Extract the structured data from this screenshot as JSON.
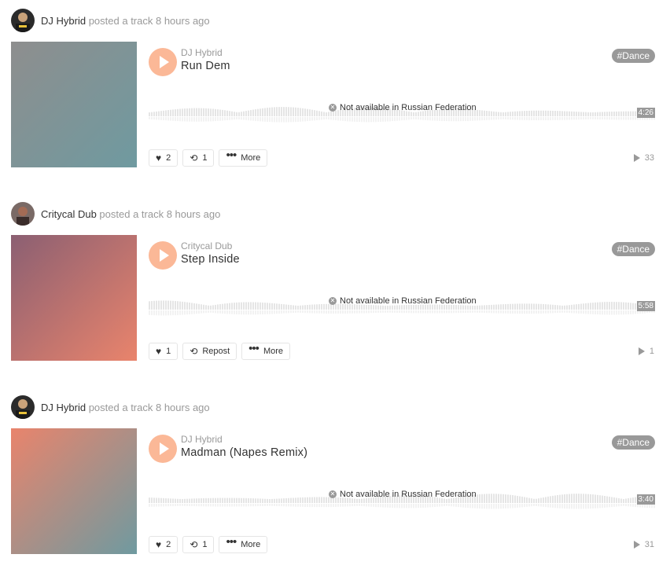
{
  "posts": [
    {
      "user": "DJ Hybrid",
      "action": "posted a track 8 hours ago",
      "artist": "DJ Hybrid",
      "title": "Run Dem",
      "tag": "#Dance",
      "availability": "Not available in Russian Federation",
      "duration": "4:26",
      "likes": "2",
      "reposts": "1",
      "more_label": "More",
      "plays": "33",
      "art_colors": [
        "#8e8e8e",
        "#6f9aa0"
      ]
    },
    {
      "user": "Critycal Dub",
      "action": "posted a track 8 hours ago",
      "artist": "Critycal Dub",
      "title": "Step Inside",
      "tag": "#Dance",
      "availability": "Not available in Russian Federation",
      "duration": "5:58",
      "likes": "1",
      "reposts": "Repost",
      "more_label": "More",
      "plays": "1",
      "art_colors": [
        "#8b5f72",
        "#e9846c"
      ]
    },
    {
      "user": "DJ Hybrid",
      "action": "posted a track 8 hours ago",
      "artist": "DJ Hybrid",
      "title": "Madman (Napes Remix)",
      "tag": "#Dance",
      "availability": "Not available in Russian Federation",
      "duration": "3:40",
      "likes": "2",
      "reposts": "1",
      "more_label": "More",
      "plays": "31",
      "art_colors": [
        "#e9846c",
        "#6f9aa0"
      ]
    }
  ],
  "colors": {
    "accent": "#fbb897",
    "muted": "#999999",
    "waveform": "#e5e5e5"
  }
}
